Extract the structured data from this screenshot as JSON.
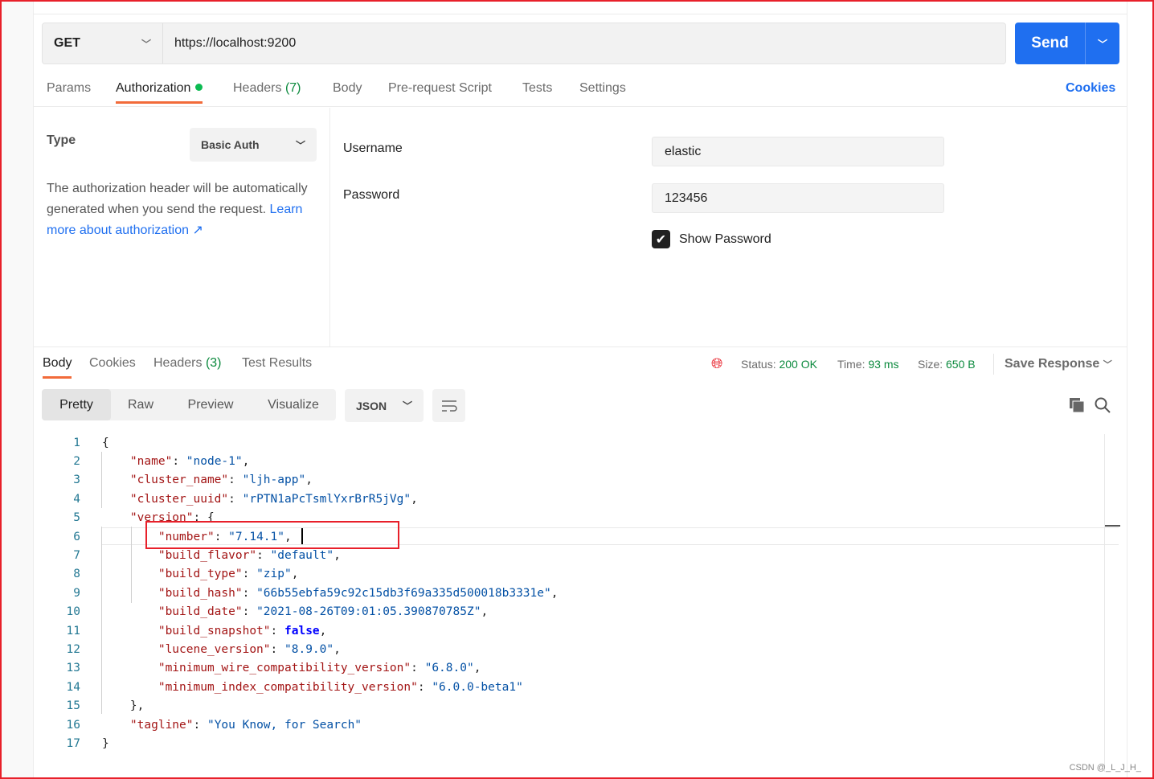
{
  "request": {
    "method": "GET",
    "url": "https://localhost:9200",
    "send_label": "Send"
  },
  "tabs": [
    {
      "label": "Params"
    },
    {
      "label": "Authorization"
    },
    {
      "label": "Headers",
      "count": "(7)"
    },
    {
      "label": "Body"
    },
    {
      "label": "Pre-request Script"
    },
    {
      "label": "Tests"
    },
    {
      "label": "Settings"
    }
  ],
  "cookies_label": "Cookies",
  "auth": {
    "type_label": "Type",
    "type_value": "Basic Auth",
    "desc": "The authorization header will be automatically generated when you send the request. ",
    "learn_more": "Learn more about authorization ↗",
    "username_label": "Username",
    "username": "elastic",
    "password_label": "Password",
    "password": "123456",
    "show_password": "Show Password",
    "show_password_checked": true
  },
  "response": {
    "tabs": [
      {
        "label": "Body"
      },
      {
        "label": "Cookies"
      },
      {
        "label": "Headers",
        "count": "(3)"
      },
      {
        "label": "Test Results"
      }
    ],
    "status_label": "Status:",
    "status": "200 OK",
    "time_label": "Time:",
    "time": "93 ms",
    "size_label": "Size:",
    "size": "650 B",
    "save": "Save Response",
    "views": [
      "Pretty",
      "Raw",
      "Preview",
      "Visualize"
    ],
    "format": "JSON",
    "lines": [
      [
        [
          "p",
          "{"
        ]
      ],
      [
        [
          "p",
          "    "
        ],
        [
          "k",
          "\"name\""
        ],
        [
          "p",
          ": "
        ],
        [
          "s",
          "\"node-1\""
        ],
        [
          "p",
          ","
        ]
      ],
      [
        [
          "p",
          "    "
        ],
        [
          "k",
          "\"cluster_name\""
        ],
        [
          "p",
          ": "
        ],
        [
          "s",
          "\"ljh-app\""
        ],
        [
          "p",
          ","
        ]
      ],
      [
        [
          "p",
          "    "
        ],
        [
          "k",
          "\"cluster_uuid\""
        ],
        [
          "p",
          ": "
        ],
        [
          "s",
          "\"rPTN1aPcTsmlYxrBrR5jVg\""
        ],
        [
          "p",
          ","
        ]
      ],
      [
        [
          "p",
          "    "
        ],
        [
          "k",
          "\"version\""
        ],
        [
          "p",
          ": {"
        ]
      ],
      [
        [
          "p",
          "        "
        ],
        [
          "k",
          "\"number\""
        ],
        [
          "p",
          ": "
        ],
        [
          "s",
          "\"7.14.1\""
        ],
        [
          "p",
          ","
        ]
      ],
      [
        [
          "p",
          "        "
        ],
        [
          "k",
          "\"build_flavor\""
        ],
        [
          "p",
          ": "
        ],
        [
          "s",
          "\"default\""
        ],
        [
          "p",
          ","
        ]
      ],
      [
        [
          "p",
          "        "
        ],
        [
          "k",
          "\"build_type\""
        ],
        [
          "p",
          ": "
        ],
        [
          "s",
          "\"zip\""
        ],
        [
          "p",
          ","
        ]
      ],
      [
        [
          "p",
          "        "
        ],
        [
          "k",
          "\"build_hash\""
        ],
        [
          "p",
          ": "
        ],
        [
          "s",
          "\"66b55ebfa59c92c15db3f69a335d500018b3331e\""
        ],
        [
          "p",
          ","
        ]
      ],
      [
        [
          "p",
          "        "
        ],
        [
          "k",
          "\"build_date\""
        ],
        [
          "p",
          ": "
        ],
        [
          "s",
          "\"2021-08-26T09:01:05.390870785Z\""
        ],
        [
          "p",
          ","
        ]
      ],
      [
        [
          "p",
          "        "
        ],
        [
          "k",
          "\"build_snapshot\""
        ],
        [
          "p",
          ": "
        ],
        [
          "b",
          "false"
        ],
        [
          "p",
          ","
        ]
      ],
      [
        [
          "p",
          "        "
        ],
        [
          "k",
          "\"lucene_version\""
        ],
        [
          "p",
          ": "
        ],
        [
          "s",
          "\"8.9.0\""
        ],
        [
          "p",
          ","
        ]
      ],
      [
        [
          "p",
          "        "
        ],
        [
          "k",
          "\"minimum_wire_compatibility_version\""
        ],
        [
          "p",
          ": "
        ],
        [
          "s",
          "\"6.8.0\""
        ],
        [
          "p",
          ","
        ]
      ],
      [
        [
          "p",
          "        "
        ],
        [
          "k",
          "\"minimum_index_compatibility_version\""
        ],
        [
          "p",
          ": "
        ],
        [
          "s",
          "\"6.0.0-beta1\""
        ]
      ],
      [
        [
          "p",
          "    },"
        ]
      ],
      [
        [
          "p",
          "    "
        ],
        [
          "k",
          "\"tagline\""
        ],
        [
          "p",
          ": "
        ],
        [
          "s",
          "\"You Know, for Search\""
        ]
      ],
      [
        [
          "p",
          "}"
        ]
      ]
    ]
  },
  "watermark": "CSDN @_L_J_H_",
  "colors": {
    "accent": "#1f6ff0",
    "active_tab": "#f26b3a",
    "success": "#0c8a3e",
    "highlight": "#e8202a"
  }
}
